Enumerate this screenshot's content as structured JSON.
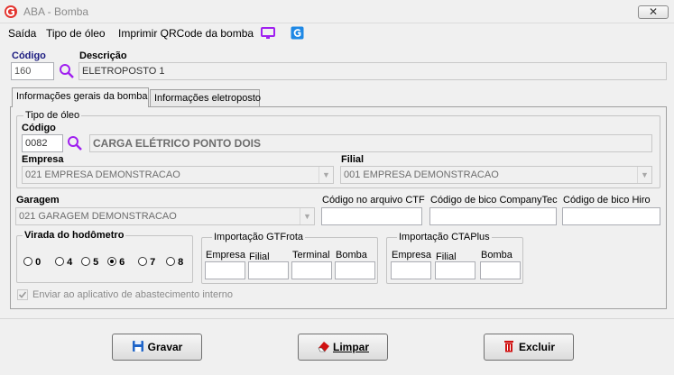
{
  "window": {
    "title": "ABA - Bomba",
    "close_label": "✕"
  },
  "menu": {
    "items": [
      "Saída",
      "Tipo de óleo",
      "Imprimir QRCode da bomba"
    ]
  },
  "header": {
    "codigo_label": "Código",
    "codigo_value": "160",
    "descricao_label": "Descrição",
    "descricao_value": "ELETROPOSTO 1"
  },
  "tabs": [
    "Informações gerais da bomba",
    "Informações eletroposto"
  ],
  "tipo_oleo": {
    "group_label": "Tipo de óleo",
    "codigo_label": "Código",
    "codigo_value": "0082",
    "descricao_value": "CARGA ELÉTRICO PONTO DOIS"
  },
  "empresa": {
    "label": "Empresa",
    "value": "021 EMPRESA DEMONSTRACAO"
  },
  "filial": {
    "label": "Filial",
    "value": "001 EMPRESA DEMONSTRACAO"
  },
  "garagem": {
    "label": "Garagem",
    "value": "021 GARAGEM DEMONSTRACAO"
  },
  "codigo_ctf": {
    "label": "Código no arquivo CTF",
    "value": ""
  },
  "codigo_bico_companytec": {
    "label": "Código de bico CompanyTec",
    "value": ""
  },
  "codigo_bico_hiro": {
    "label": "Código de bico Hiro",
    "value": ""
  },
  "virada_hodometro": {
    "label": "Virada do hodômetro",
    "options": [
      "0",
      "4",
      "5",
      "6",
      "7",
      "8"
    ],
    "selected": "6"
  },
  "importacao_gtfrota": {
    "label": "Importação GTFrota",
    "fields": [
      "Empresa",
      "Filial",
      "Terminal",
      "Bomba"
    ]
  },
  "importacao_ctaplus": {
    "label": "Importação CTAPlus",
    "fields": [
      "Empresa",
      "Filial",
      "Bomba"
    ]
  },
  "enviar_aplicativo": {
    "label": "Enviar ao aplicativo de abastecimento interno",
    "checked": true
  },
  "buttons": {
    "gravar": "Gravar",
    "limpar": "Limpar",
    "excluir": "Excluir"
  },
  "colors": {
    "accent_purple": "#a020f0",
    "save_blue": "#1e64c8",
    "delete_red": "#d01010",
    "title_gray": "#8a8a8a"
  },
  "icons": {
    "app": "g-logo-icon",
    "search": "magnifier-icon",
    "monitor": "monitor-icon",
    "qrcode": "g-app-icon"
  }
}
